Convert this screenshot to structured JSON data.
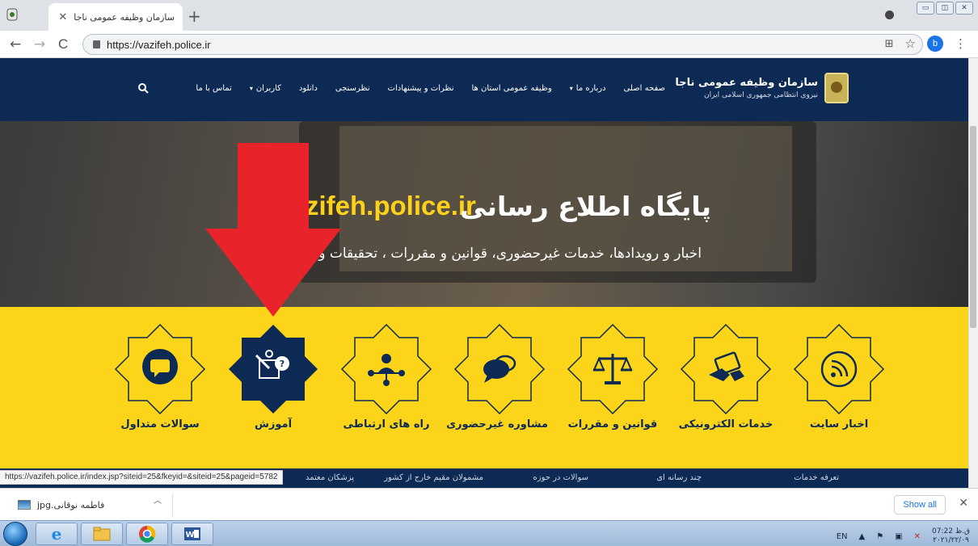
{
  "browser": {
    "tab_title": "سازمان وظیفه عمومی ناجا",
    "tab_close": "✕",
    "new_tab": "+",
    "url": "https://vazifeh.police.ir",
    "profile_initial": "b",
    "back": "←",
    "forward": "→",
    "reload": "C",
    "bookmark_star": "☆",
    "menu": "⋮"
  },
  "site": {
    "brand_title": "سازمان وظیفه عمومی ناجا",
    "brand_subtitle": "نیروی انتظامی جمهوری اسلامی ایران",
    "menu": [
      {
        "label": "صفحه اصلی",
        "caret": ""
      },
      {
        "label": "درباره ما",
        "caret": "▾"
      },
      {
        "label": "وظیفه عمومی استان ها",
        "caret": ""
      },
      {
        "label": "نظرات و پیشنهادات",
        "caret": ""
      },
      {
        "label": "نظرسنجی",
        "caret": ""
      },
      {
        "label": "دانلود",
        "caret": ""
      },
      {
        "label": "کاربران",
        "caret": "▾"
      },
      {
        "label": "تماس با ما",
        "caret": ""
      }
    ],
    "hero_title": "پایگاه اطلاع رسانی",
    "hero_domain": "zifeh.police.ir",
    "hero_subtitle": "اخبار و رویدادها، خدمات غیرحضوری، قوانین و مقررات ، تحقیقات و پ",
    "services": [
      {
        "label": "اخبار سایت",
        "icon": "rss-icon"
      },
      {
        "label": "خدمات الکترونیکی",
        "icon": "tablet-hand-icon"
      },
      {
        "label": "قوانین و مقررات",
        "icon": "scales-icon"
      },
      {
        "label": "مشاوره غیرحضوری",
        "icon": "chat-bubbles-icon"
      },
      {
        "label": "راه های ارتباطی",
        "icon": "network-icon"
      },
      {
        "label": "آموزش",
        "icon": "education-icon"
      },
      {
        "label": "سوالات متداول",
        "icon": "faq-chat-icon"
      }
    ],
    "subnav": [
      "تعرفه خدمات",
      "چند رسانه ای",
      "سوالات در حوزه",
      "مشمولان مقیم خارج از کشور",
      "پزشکان معتمد"
    ],
    "status_url": "https://vazifeh.police.ir/index.jsp?siteid=25&fkeyid=&siteid=25&pageid=5782"
  },
  "downloads": {
    "file_name": "فاطمه نوقانی.jpg",
    "show_all": "Show all",
    "close": "✕"
  },
  "taskbar": {
    "lang": "EN",
    "time": "07:22 ق.ظ",
    "date": "۲۰۲۱/۲۲/۰۹"
  },
  "colors": {
    "header_navy": "#0d2a55",
    "band_yellow": "#fcd51a",
    "arrow_red": "#e8232a",
    "highlight_navy": "#0d2a55"
  }
}
